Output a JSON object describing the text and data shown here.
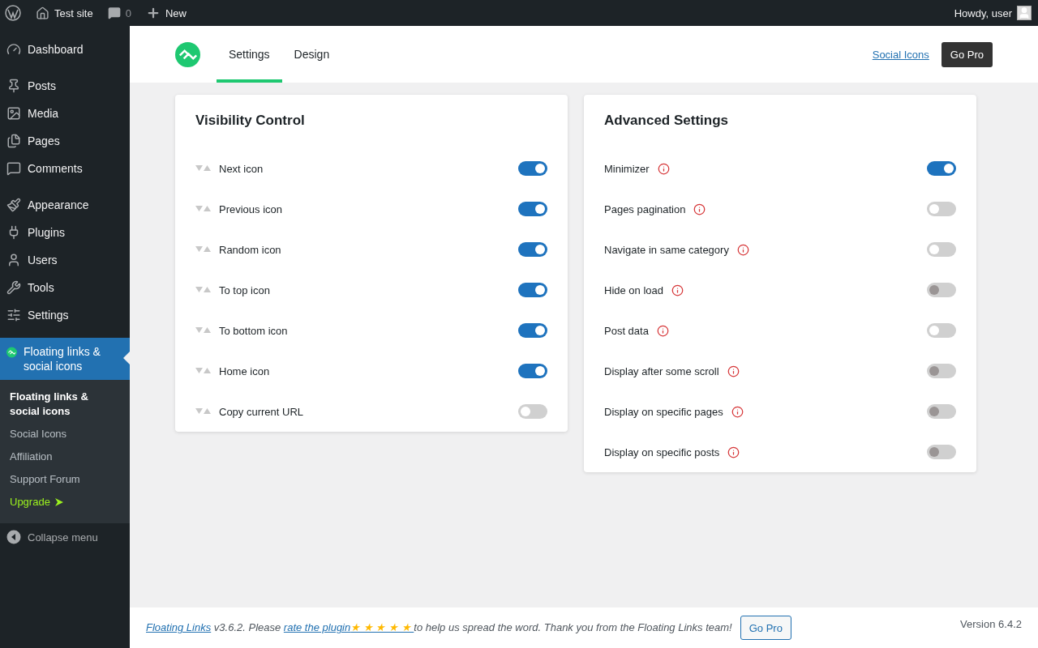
{
  "admin_bar": {
    "site": "Test site",
    "comments": "0",
    "new": "New",
    "greeting": "Howdy, user"
  },
  "sidebar": {
    "groups": [
      [
        {
          "label": "Dashboard"
        }
      ],
      [
        {
          "label": "Posts"
        },
        {
          "label": "Media"
        },
        {
          "label": "Pages"
        },
        {
          "label": "Comments"
        }
      ],
      [
        {
          "label": "Appearance"
        },
        {
          "label": "Plugins"
        },
        {
          "label": "Users"
        },
        {
          "label": "Tools"
        },
        {
          "label": "Settings"
        }
      ]
    ],
    "active": {
      "label": "Floating links & social icons",
      "selected": true
    },
    "submenu": [
      {
        "label": "Floating links & social icons",
        "selected": true,
        "kind": "link"
      },
      {
        "label": "Social Icons",
        "selected": false,
        "kind": "link"
      },
      {
        "label": "Affiliation",
        "selected": false,
        "kind": "link"
      },
      {
        "label": "Support Forum",
        "selected": false,
        "kind": "link"
      },
      {
        "label": "Upgrade",
        "selected": false,
        "kind": "upgrade"
      }
    ],
    "collapse": "Collapse menu"
  },
  "header": {
    "tabs": [
      {
        "label": "Settings",
        "selected": true
      },
      {
        "label": "Design",
        "selected": false
      }
    ],
    "link": "Social Icons",
    "button": "Go Pro"
  },
  "panels": [
    {
      "title": "Visibility Control",
      "kind": "sortable",
      "rows": [
        {
          "label": "Next icon",
          "on": true,
          "disabled": false
        },
        {
          "label": "Previous icon",
          "on": true,
          "disabled": false
        },
        {
          "label": "Random icon",
          "on": true,
          "disabled": false
        },
        {
          "label": "To top icon",
          "on": true,
          "disabled": false
        },
        {
          "label": "To bottom icon",
          "on": true,
          "disabled": false
        },
        {
          "label": "Home icon",
          "on": true,
          "disabled": false
        },
        {
          "label": "Copy current URL",
          "on": false,
          "disabled": false
        }
      ]
    },
    {
      "title": "Advanced Settings",
      "kind": "info",
      "rows": [
        {
          "label": "Minimizer",
          "on": true,
          "disabled": false
        },
        {
          "label": "Pages pagination",
          "on": false,
          "disabled": false
        },
        {
          "label": "Navigate in same category",
          "on": false,
          "disabled": false
        },
        {
          "label": "Hide on load",
          "on": false,
          "disabled": true
        },
        {
          "label": "Post data",
          "on": false,
          "disabled": false
        },
        {
          "label": "Display after some scroll",
          "on": false,
          "disabled": true
        },
        {
          "label": "Display on specific pages",
          "on": false,
          "disabled": true
        },
        {
          "label": "Display on specific posts",
          "on": false,
          "disabled": true
        }
      ]
    }
  ],
  "footer": {
    "plugin_link": "Floating Links",
    "text_1": " v3.6.2. Please ",
    "rate_link": "rate the plugin",
    "rate_stars": "★ ★ ★ ★ ★ ",
    "text_2": "to help us spread the word. Thank you from the Floating Links team!",
    "button": "Go Pro",
    "version": "Version 6.4.2"
  }
}
